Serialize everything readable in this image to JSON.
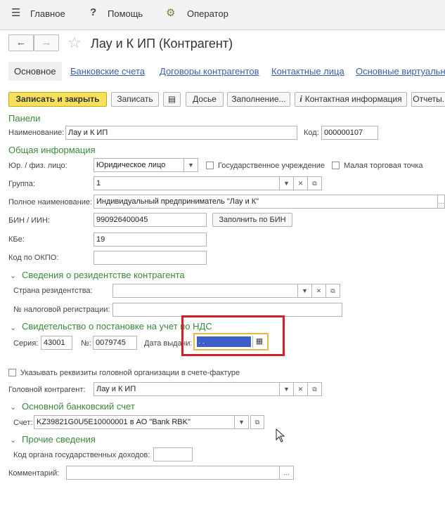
{
  "topbar": {
    "main": "Главное",
    "help": "Помощь",
    "operator": "Оператор"
  },
  "title": "Лау и К ИП (Контрагент)",
  "tabs": [
    "Основное",
    "Банковские счета",
    "Договоры контрагентов",
    "Контактные лица",
    "Основные виртуальн"
  ],
  "toolbar": {
    "save_close": "Записать и закрыть",
    "save": "Записать",
    "dossier": "Досье",
    "fill": "Заполнение...",
    "contact_info": "Контактная информация",
    "reports": "Отчеты..."
  },
  "panels_label": "Панели",
  "name_label": "Наименование:",
  "name_value": "Лау и К ИП",
  "code_label": "Код:",
  "code_value": "000000107",
  "general_section": "Общая информация",
  "entity_label": "Юр. / физ. лицо:",
  "entity_value": "Юридическое лицо",
  "state_inst_label": "Государственное учреждение",
  "small_point_label": "Малая торговая точка",
  "group_label": "Группа:",
  "group_value": "1",
  "full_name_label": "Полное наименование:",
  "full_name_value": "Индивидуальный предприниматель \"Лау и К\"",
  "bin_label": "БИН / ИИН:",
  "bin_value": "990926400045",
  "fill_bin": "Заполнить по БИН",
  "kbe_label": "КБе:",
  "kbe_value": "19",
  "okpo_label": "Код по ОКПО:",
  "okpo_value": "",
  "residency_section": "Сведения о резидентстве контрагента",
  "country_label": "Страна резидентства:",
  "country_value": "",
  "tax_reg_label": "№ налоговой регистрации:",
  "tax_reg_value": "",
  "vat_section": "Свидетельство о постановке на учет по НДС",
  "series_label": "Серия:",
  "series_value": "43001",
  "number_label": "№:",
  "number_value": "0079745",
  "issue_date_label": "Дата выдачи:",
  "issue_date_value": " .  .  ",
  "head_org_label": "Указывать реквизиты головной организации в счете-фактуре",
  "head_counterparty_label": "Головной контрагент:",
  "head_counterparty_value": "Лау и К ИП",
  "bank_section": "Основной банковский счет",
  "account_label": "Счет:",
  "account_value": "KZ39821G0U5E10000001 в АО \"Bank RBK\"",
  "other_section": "Прочие сведения",
  "gov_income_label": "Код органа государственных доходов:",
  "gov_income_value": "",
  "comment_label": "Комментарий:",
  "comment_value": "",
  "colors": {
    "accent_green": "#3a8a3a",
    "link_blue": "#3d5ea8",
    "primary_yellow": "#f6e05d",
    "highlight_red": "#d0202a",
    "focus_orange": "#e8b84a"
  }
}
